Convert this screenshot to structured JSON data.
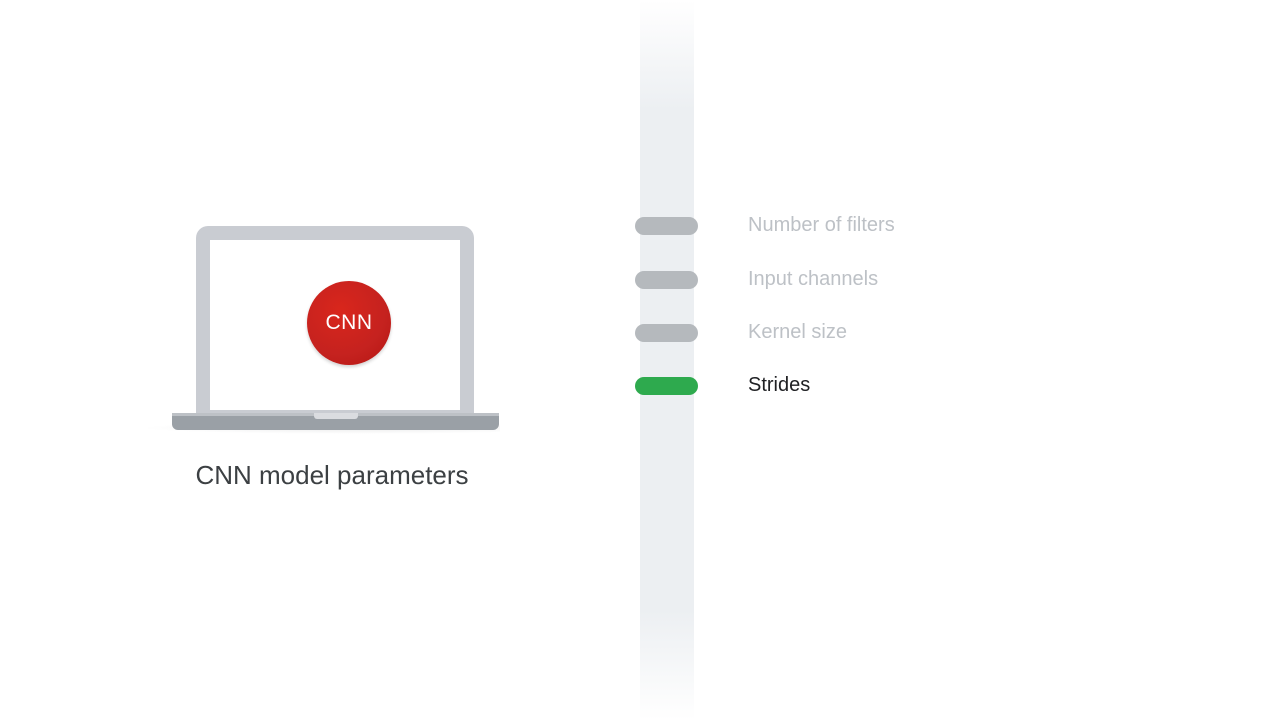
{
  "laptop": {
    "badge_text": "CNN",
    "caption": "CNN model parameters",
    "badge_color": "#c5221f"
  },
  "parameters": [
    {
      "label": "Number of filters",
      "active": false
    },
    {
      "label": "Input channels",
      "active": false
    },
    {
      "label": "Kernel size",
      "active": false
    },
    {
      "label": "Strides",
      "active": true
    }
  ],
  "colors": {
    "active_pill": "#2eaa4e",
    "inactive_pill": "#b5b9bd",
    "inactive_text": "#bdc1c6",
    "active_text": "#202124",
    "track": "#eceff2"
  }
}
